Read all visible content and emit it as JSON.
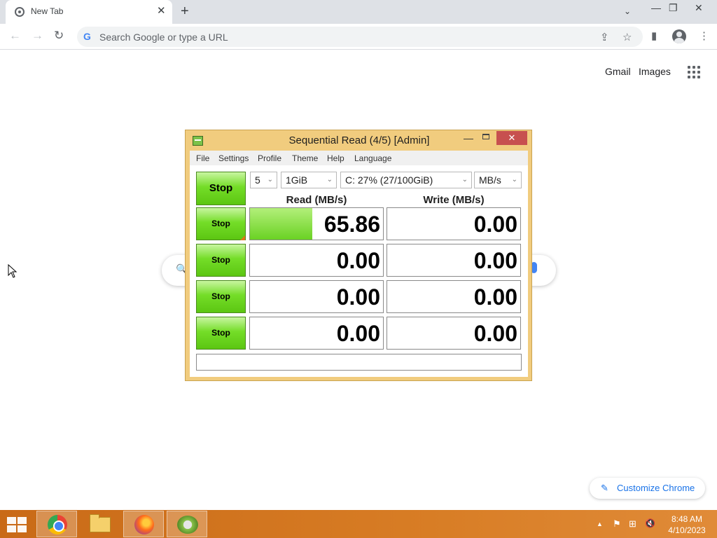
{
  "browser": {
    "tab_title": "New Tab",
    "tab_close": "✕",
    "new_tab": "+",
    "tab_search": "⌄",
    "minimize": "—",
    "restore": "❐",
    "close": "✕",
    "back": "←",
    "forward": "→",
    "reload": "↻",
    "omnibox_placeholder": "Search Google or type a URL",
    "share": "⇪",
    "bookmark": "☆",
    "side_panel": "▮",
    "menu": "⋮",
    "google_g": "G"
  },
  "ntp": {
    "gmail": "Gmail",
    "images": "Images",
    "search_icon": "🔍",
    "customize_icon": "✎",
    "customize_label": "Customize Chrome"
  },
  "cdm": {
    "title": "Sequential Read (4/5) [Admin]",
    "min": "—",
    "close": "✕",
    "menu": [
      "File",
      "Settings",
      "Profile",
      "Theme",
      "Help",
      "Language"
    ],
    "stop_all": "Stop",
    "count": "5",
    "size": "1GiB",
    "drive": "C: 27% (27/100GiB)",
    "unit": "MB/s",
    "arrow": "⌄",
    "read_header": "Read (MB/s)",
    "write_header": "Write (MB/s)",
    "rows": [
      {
        "stop": "Stop",
        "read": "65.86",
        "write": "0.00",
        "read_progress": 0.47
      },
      {
        "stop": "Stop",
        "read": "0.00",
        "write": "0.00",
        "read_progress": 0
      },
      {
        "stop": "Stop",
        "read": "0.00",
        "write": "0.00",
        "read_progress": 0
      },
      {
        "stop": "Stop",
        "read": "0.00",
        "write": "0.00",
        "read_progress": 0
      }
    ],
    "comment": ""
  },
  "taskbar": {
    "tray_up": "▲",
    "tray_flag": "⚑",
    "tray_network": "⊞",
    "tray_volume": "🔇",
    "time": "8:48 AM",
    "date": "4/10/2023"
  }
}
